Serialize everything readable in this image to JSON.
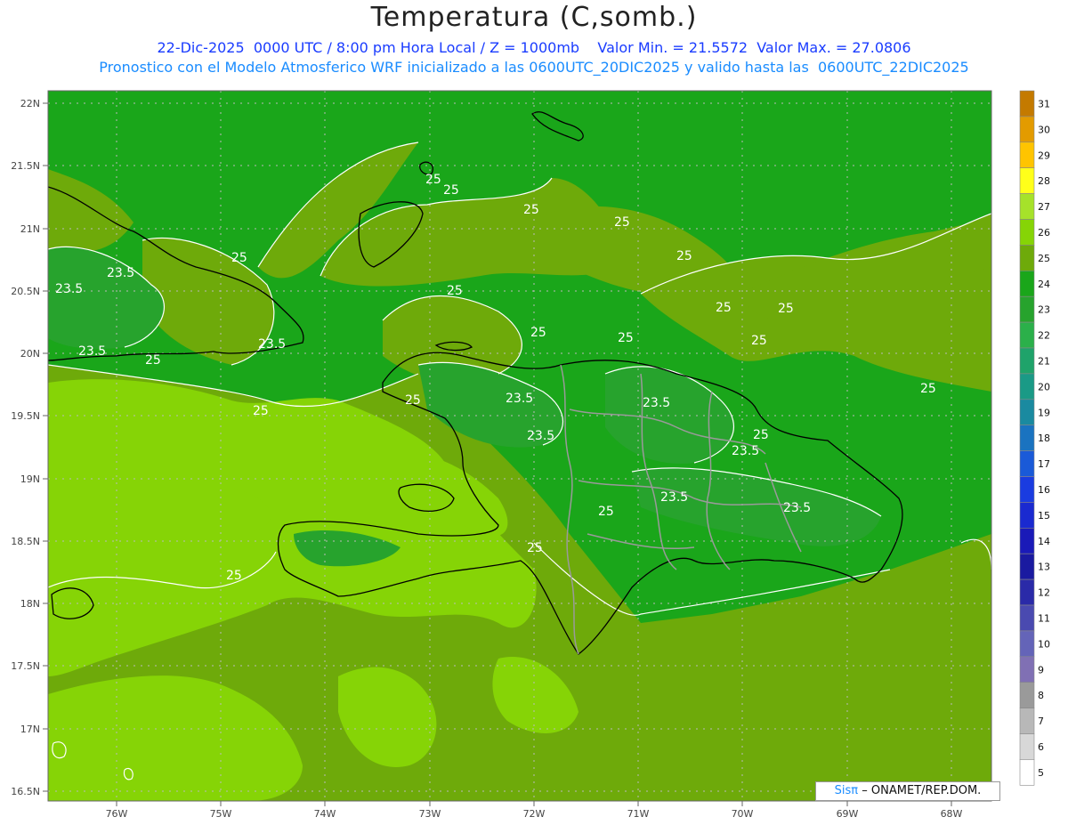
{
  "header": {
    "title": "Temperatura (C,somb.)",
    "line1": "22-Dic-2025  0000 UTC / 8:00 pm Hora Local / Z = 1000mb    Valor Min. = 21.5572  Valor Max. = 27.0806",
    "line2": "Pronostico con el Modelo Atmosferico WRF inicializado a las 0600UTC_20DIC2025 y valido hasta las  0600UTC_22DIC2025"
  },
  "map": {
    "lat_labels": [
      "22N",
      "21.5N",
      "21N",
      "20.5N",
      "20N",
      "19.5N",
      "19N",
      "18.5N",
      "18N",
      "17.5N",
      "17N",
      "16.5N"
    ],
    "lon_labels": [
      "76W",
      "75W",
      "74W",
      "73W",
      "72W",
      "71W",
      "70W",
      "69W",
      "68W"
    ],
    "contour_labels": [
      "25",
      "25",
      "25",
      "25",
      "25",
      "25",
      "25",
      "25",
      "25",
      "25",
      "25",
      "25",
      "25",
      "25",
      "25",
      "25",
      "25",
      "25",
      "25",
      "25",
      "23.5",
      "23.5",
      "23.5",
      "23.5",
      "23.5",
      "23.5",
      "23.5",
      "23.5",
      "23.5",
      "23.5"
    ],
    "colors": {
      "t24": "#1aa61a",
      "t23": "#27a32d",
      "t25": "#6eaa0a",
      "t26": "#86d406",
      "t27": "#a6e22a",
      "coast": "#000000",
      "province_border": "#9a9a9a",
      "contour": "#ffffff"
    }
  },
  "colorbar": {
    "labels": [
      "31",
      "30",
      "29",
      "28",
      "27",
      "26",
      "25",
      "24",
      "23",
      "22",
      "21",
      "20",
      "19",
      "18",
      "17",
      "16",
      "15",
      "14",
      "13",
      "12",
      "11",
      "10",
      "9",
      "8",
      "7",
      "6",
      "5"
    ],
    "colors": [
      "#c47a00",
      "#e39b00",
      "#ffc400",
      "#ffff1a",
      "#a6e22a",
      "#86d406",
      "#6eaa0a",
      "#1aa61a",
      "#27a32d",
      "#2bb04a",
      "#1fa36a",
      "#1a9a86",
      "#1a8aa0",
      "#1a73c0",
      "#1a5ad8",
      "#1a3ce0",
      "#1a2ad0",
      "#1a1ab8",
      "#1a1aa0",
      "#2a2aa8",
      "#4a4ab0",
      "#6464b8",
      "#8070b4",
      "#9a9a9a",
      "#b8b8b8",
      "#d8d8d8",
      "#ffffff"
    ]
  },
  "credit": {
    "sis": "Sisπ",
    "org": "– ONAMET/REP.DOM."
  }
}
